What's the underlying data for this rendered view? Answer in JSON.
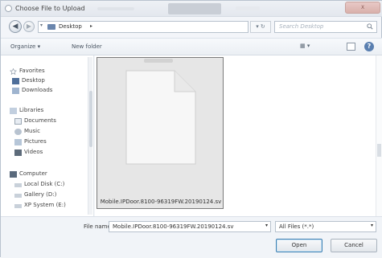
{
  "window": {
    "title": "Choose File to Upload",
    "close_label": "X"
  },
  "nav": {
    "back_glyph": "◀",
    "forward_glyph": "▶",
    "address_dropdown": "▾",
    "address": "Desktop",
    "address_sep": "▸",
    "refresh_glyph": "▾ ↻",
    "search_placeholder": "Search Desktop"
  },
  "toolbar": {
    "organize": "Organize ▾",
    "new_folder": "New folder",
    "view_glyph": "▦ ▾",
    "help_glyph": "?"
  },
  "sidebar": {
    "items": [
      {
        "label": "Favorites",
        "icon": "star-icon"
      },
      {
        "label": "Desktop",
        "icon": "desktop-icon"
      },
      {
        "label": "Downloads",
        "icon": "downloads-icon"
      },
      {
        "label": "Libraries",
        "icon": "libraries-icon"
      },
      {
        "label": "Documents",
        "icon": "documents-icon"
      },
      {
        "label": "Music",
        "icon": "music-icon"
      },
      {
        "label": "Pictures",
        "icon": "pictures-icon"
      },
      {
        "label": "Videos",
        "icon": "videos-icon"
      },
      {
        "label": "Computer",
        "icon": "computer-icon"
      },
      {
        "label": "Local Disk (C:)",
        "icon": "drive-icon"
      },
      {
        "label": "Gallery (D:)",
        "icon": "drive-icon"
      },
      {
        "label": "XP System (E:)",
        "icon": "drive-icon"
      }
    ]
  },
  "content": {
    "file_name": "Mobile.IPDoor.8100-96319FW.20190124.sv"
  },
  "bottom": {
    "file_name_label": "File name:",
    "file_name_value": "Mobile.IPDoor.8100-96319FW.20190124.sv",
    "file_type": "All Files (*.*)",
    "dropdown_glyph": "▾",
    "open_label": "Open",
    "cancel_label": "Cancel"
  },
  "colors": {
    "accent": "#3c7fb1",
    "selection_fill": "#e6e6e6"
  }
}
